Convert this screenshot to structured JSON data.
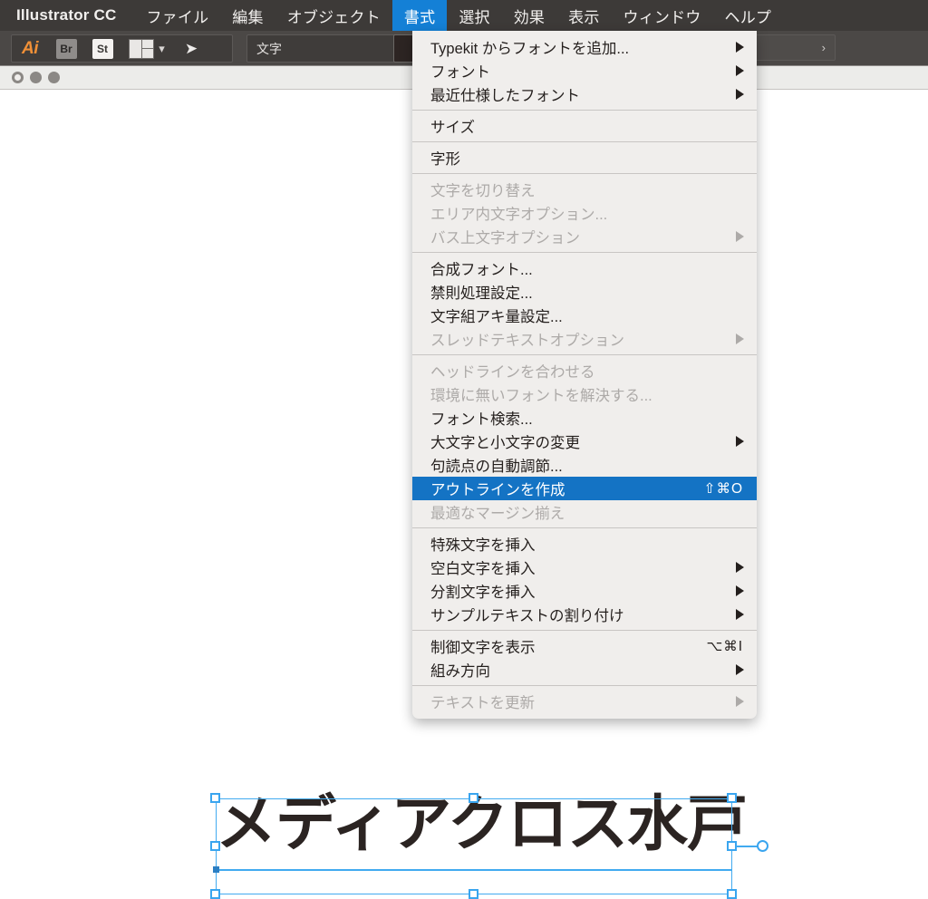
{
  "menubar": {
    "app_name": "Illustrator CC",
    "items": [
      {
        "label": "ファイル",
        "active": false
      },
      {
        "label": "編集",
        "active": false
      },
      {
        "label": "オブジェクト",
        "active": false
      },
      {
        "label": "書式",
        "active": true
      },
      {
        "label": "選択",
        "active": false
      },
      {
        "label": "効果",
        "active": false
      },
      {
        "label": "表示",
        "active": false
      },
      {
        "label": "ウィンドウ",
        "active": false
      },
      {
        "label": "ヘルプ",
        "active": false
      }
    ],
    "active_color": "#1480d6",
    "bar_color": "#3d3a38"
  },
  "toolbar": {
    "ai_label": "Ai",
    "br_label": "Br",
    "st_label": "St",
    "arrange_icon": "arrange-documents-icon",
    "rocket_icon": "launch-icon",
    "chevron_icon": "chevron-down-icon",
    "workspace_label": "文字",
    "fill_swatch_color": "#2d2523",
    "zoom_label": "%",
    "zoom_caret": "›"
  },
  "document_window": {
    "close_button": "close-button",
    "minimize_button": "minimize-button",
    "zoom_button": "zoom-button"
  },
  "menu": {
    "title": "書式",
    "groups": [
      {
        "items": [
          {
            "label": "Typekit からフォントを追加...",
            "shortcut": "",
            "arrow": true,
            "disabled": false,
            "selected": false
          },
          {
            "label": "フォント",
            "shortcut": "",
            "arrow": true,
            "disabled": false,
            "selected": false
          },
          {
            "label": "最近仕様したフォント",
            "shortcut": "",
            "arrow": true,
            "disabled": false,
            "selected": false
          }
        ]
      },
      {
        "items": [
          {
            "label": "サイズ",
            "shortcut": "",
            "arrow": false,
            "disabled": false,
            "selected": false
          }
        ]
      },
      {
        "items": [
          {
            "label": "字形",
            "shortcut": "",
            "arrow": false,
            "disabled": false,
            "selected": false
          }
        ]
      },
      {
        "items": [
          {
            "label": "文字を切り替え",
            "shortcut": "",
            "arrow": false,
            "disabled": true,
            "selected": false
          },
          {
            "label": "エリア内文字オプション...",
            "shortcut": "",
            "arrow": false,
            "disabled": true,
            "selected": false
          },
          {
            "label": "バス上文字オプション",
            "shortcut": "",
            "arrow": true,
            "disabled": true,
            "selected": false
          }
        ]
      },
      {
        "items": [
          {
            "label": "合成フォント...",
            "shortcut": "",
            "arrow": false,
            "disabled": false,
            "selected": false
          },
          {
            "label": "禁則処理設定...",
            "shortcut": "",
            "arrow": false,
            "disabled": false,
            "selected": false
          },
          {
            "label": "文字組アキ量設定...",
            "shortcut": "",
            "arrow": false,
            "disabled": false,
            "selected": false
          },
          {
            "label": "スレッドテキストオプション",
            "shortcut": "",
            "arrow": true,
            "disabled": true,
            "selected": false
          }
        ]
      },
      {
        "items": [
          {
            "label": "ヘッドラインを合わせる",
            "shortcut": "",
            "arrow": false,
            "disabled": true,
            "selected": false
          },
          {
            "label": "環境に無いフォントを解決する...",
            "shortcut": "",
            "arrow": false,
            "disabled": true,
            "selected": false
          },
          {
            "label": "フォント検索...",
            "shortcut": "",
            "arrow": false,
            "disabled": false,
            "selected": false
          },
          {
            "label": "大文字と小文字の変更",
            "shortcut": "",
            "arrow": true,
            "disabled": false,
            "selected": false
          },
          {
            "label": "句読点の自動調節...",
            "shortcut": "",
            "arrow": false,
            "disabled": false,
            "selected": false
          },
          {
            "label": "アウトラインを作成",
            "shortcut": "⇧⌘O",
            "arrow": false,
            "disabled": false,
            "selected": true
          },
          {
            "label": "最適なマージン揃え",
            "shortcut": "",
            "arrow": false,
            "disabled": true,
            "selected": false
          }
        ]
      },
      {
        "items": [
          {
            "label": "特殊文字を挿入",
            "shortcut": "",
            "arrow": false,
            "disabled": false,
            "selected": false
          },
          {
            "label": "空白文字を挿入",
            "shortcut": "",
            "arrow": true,
            "disabled": false,
            "selected": false
          },
          {
            "label": "分割文字を挿入",
            "shortcut": "",
            "arrow": true,
            "disabled": false,
            "selected": false
          },
          {
            "label": "サンプルテキストの割り付け",
            "shortcut": "",
            "arrow": true,
            "disabled": false,
            "selected": false
          }
        ]
      },
      {
        "items": [
          {
            "label": "制御文字を表示",
            "shortcut": "⌥⌘I",
            "arrow": false,
            "disabled": false,
            "selected": false
          },
          {
            "label": "組み方向",
            "shortcut": "",
            "arrow": true,
            "disabled": false,
            "selected": false
          }
        ]
      },
      {
        "items": [
          {
            "label": "テキストを更新",
            "shortcut": "",
            "arrow": true,
            "disabled": true,
            "selected": false
          }
        ]
      }
    ],
    "selected_color": "#1473c4",
    "background_color": "#f0eeec"
  },
  "canvas": {
    "artwork_text": "メディアクロス水戸",
    "artwork_color": "#2b2422",
    "selection_color": "#41aaf0"
  }
}
